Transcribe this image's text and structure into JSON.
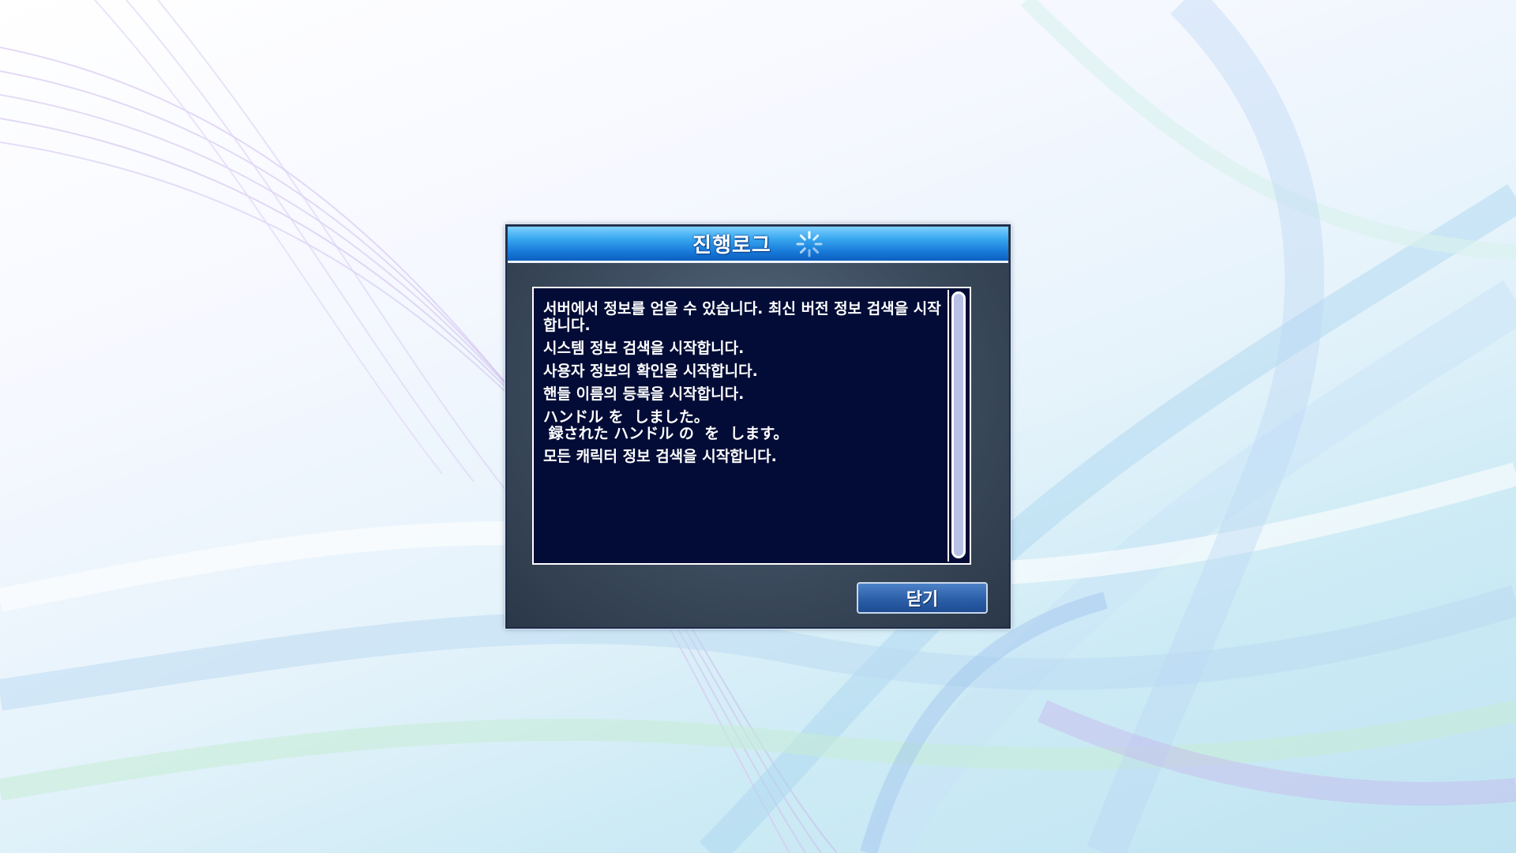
{
  "dialog": {
    "title": "진행로그",
    "spinner_icon": "loading-spinner-icon",
    "close_label": "닫기"
  },
  "log": {
    "lines": [
      "서버에서 정보를 얻을 수 있습니다. 최신 버전 정보 검색을 시작합니다.",
      "시스템 정보 검색을 시작합니다.",
      "사용자 정보의 확인을 시작합니다.",
      "핸들 이름의 등록을 시작합니다.",
      "ハンドル を  しました。\n 録された ハンドル の  を  します。",
      "모든 캐릭터 정보 검색을 시작합니다."
    ]
  },
  "colors": {
    "titlebar": "#1678d8",
    "log_background": "#020c36",
    "button": "#2b5fa8"
  }
}
